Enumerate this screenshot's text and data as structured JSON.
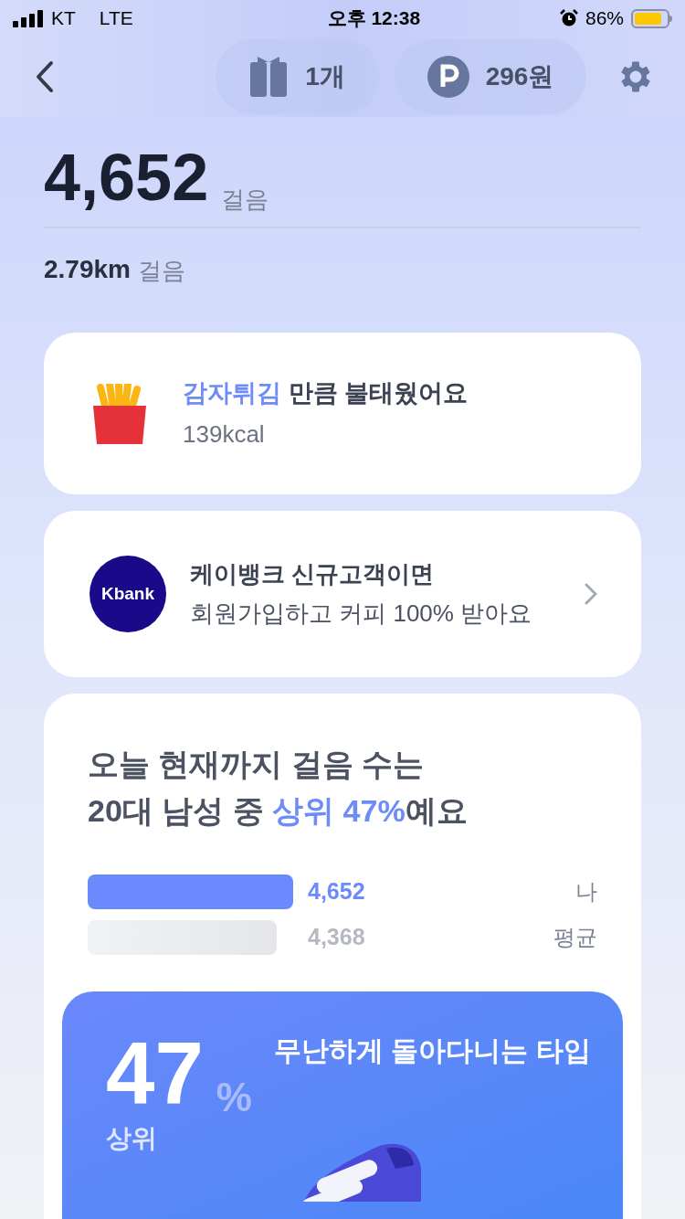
{
  "status_bar": {
    "carrier": "KT",
    "network": "LTE",
    "time": "오후 12:38",
    "battery": "86%"
  },
  "header": {
    "gift_count": "1개",
    "points": "296원"
  },
  "steps": {
    "count": "4,652",
    "unit": "걸음",
    "distance": "2.79km",
    "distance_unit": "걸음"
  },
  "calorie_card": {
    "title_parts": [
      {
        "text": "감자튀김",
        "highlight": true
      },
      {
        "text": " 만큼 불태웠어요",
        "highlight": false
      }
    ],
    "calories": "139kcal"
  },
  "promo_card": {
    "logo": "Kbank",
    "title": "케이뱅크 신규고객이면",
    "subtitle": "회원가입하고 커피 100% 받아요"
  },
  "ranking_card": {
    "line_1": "오늘 현재까지 걸음 수는",
    "line_2_parts": [
      {
        "text": "20대 남성 중 ",
        "highlight": false
      },
      {
        "text": "상위 47%",
        "highlight": true
      },
      {
        "text": "예요",
        "highlight": false
      }
    ],
    "bars": [
      {
        "kind": "me",
        "value": "4,652",
        "label": "나"
      },
      {
        "kind": "average",
        "value": "4,368",
        "label": "평균"
      }
    ],
    "type_card": {
      "percent": "47",
      "percent_sign": "%",
      "percent_label": "상위",
      "type_title": "무난하게 돌아다니는 타입"
    }
  }
}
